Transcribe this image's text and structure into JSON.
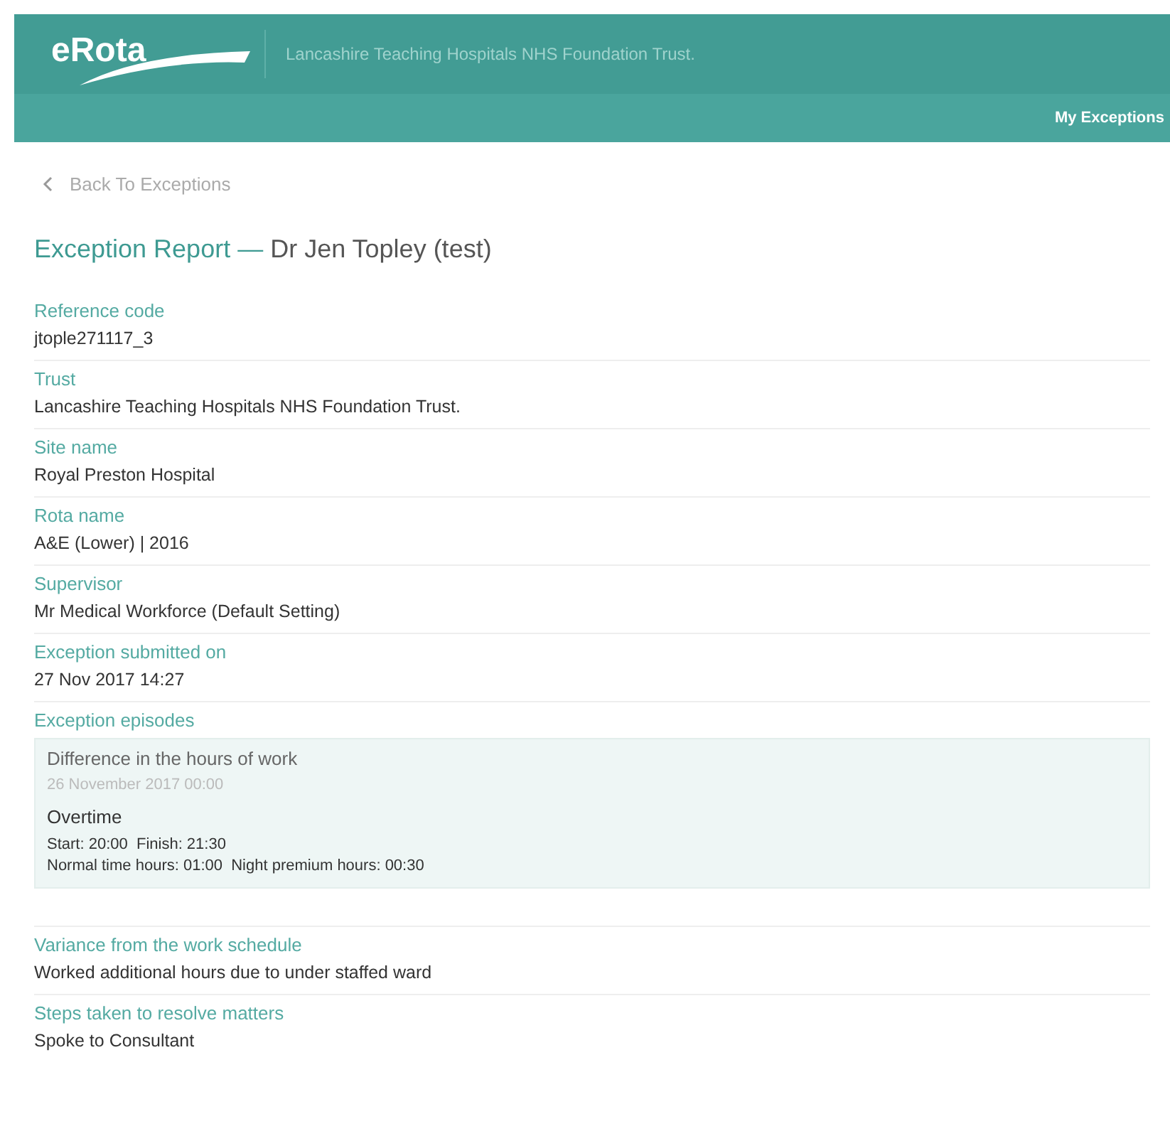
{
  "header": {
    "logo": "eRota",
    "trust": "Lancashire Teaching Hospitals NHS Foundation Trust.",
    "nav": [
      "My Exceptions"
    ]
  },
  "back_link": "Back To Exceptions",
  "title": {
    "main": "Exception Report —",
    "person": "Dr Jen Topley (test)"
  },
  "fields": [
    {
      "label": "Reference code",
      "value": "jtople271117_3"
    },
    {
      "label": "Trust",
      "value": "Lancashire Teaching Hospitals NHS Foundation Trust."
    },
    {
      "label": "Site name",
      "value": "Royal Preston Hospital"
    },
    {
      "label": "Rota name",
      "value": "A&E (Lower) | 2016"
    },
    {
      "label": "Supervisor",
      "value": "Mr Medical Workforce (Default Setting)"
    },
    {
      "label": "Exception submitted on",
      "value": "27 Nov 2017 14:27"
    }
  ],
  "episodes": {
    "label": "Exception episodes",
    "items": [
      {
        "type": "Difference in the hours of work",
        "date": "26 November 2017 00:00",
        "category": "Overtime",
        "times": "Start: 20:00  Finish: 21:30",
        "hours": "Normal time hours: 01:00  Night premium hours: 00:30"
      }
    ]
  },
  "details": [
    {
      "label": "Variance from the work schedule",
      "value": "Worked additional hours due to under staffed ward"
    },
    {
      "label": "Steps taken to resolve matters",
      "value": "Spoke to Consultant"
    }
  ]
}
